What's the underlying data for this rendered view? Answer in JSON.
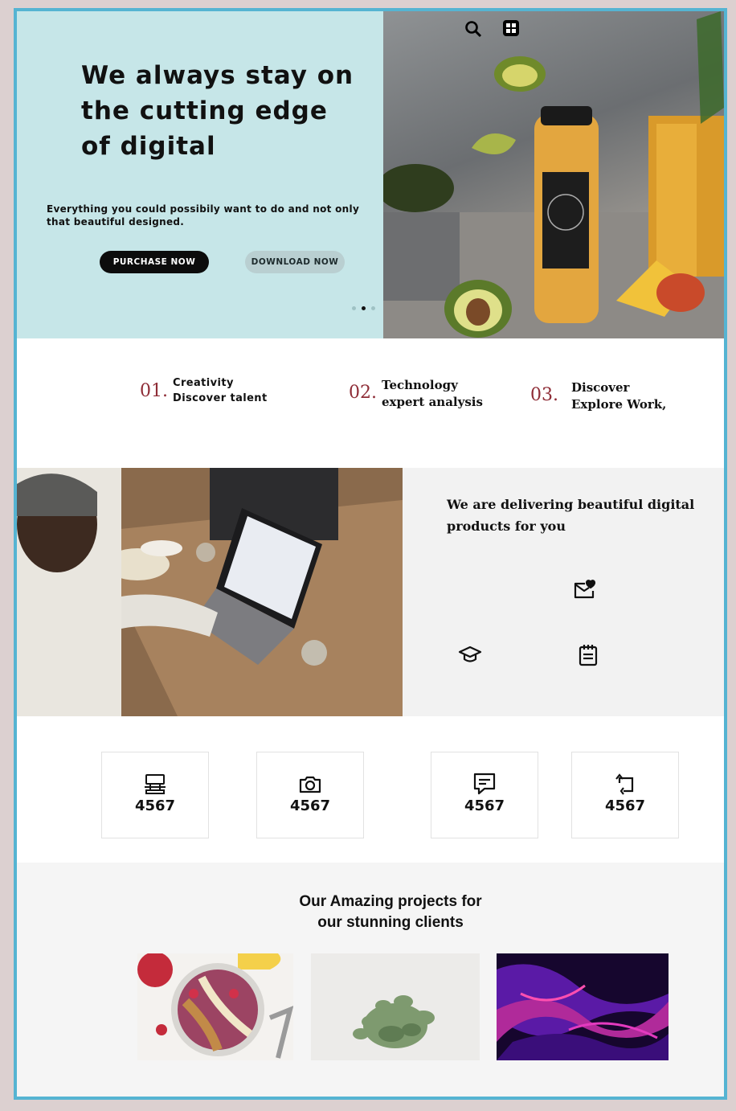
{
  "hero": {
    "title": "We always stay on the cutting edge of digital",
    "subtitle": "Everything you could possibily want to do and not only that beautiful designed.",
    "purchase_label": "PURCHASE NOW",
    "download_label": "DOWNLOAD NOW",
    "slider": {
      "dots": 3,
      "active": 2
    }
  },
  "header_icons": [
    "search-icon",
    "grid-menu-icon"
  ],
  "features": [
    {
      "number": "01.",
      "line1": "Creativity",
      "line2": "Discover talent"
    },
    {
      "number": "02.",
      "line1": "Technology",
      "line2": "expert analysis"
    },
    {
      "number": "03.",
      "line1": "Discover",
      "line2": "Explore Work,"
    }
  ],
  "about": {
    "title": "We are delivering beautiful digital products for you",
    "icons": [
      "mail-heart-icon",
      "graduation-cap-icon",
      "notepad-icon"
    ]
  },
  "stats": [
    {
      "icon": "computer-icon",
      "value": "4567"
    },
    {
      "icon": "camera-icon",
      "value": "4567"
    },
    {
      "icon": "message-icon",
      "value": "4567"
    },
    {
      "icon": "repeat-icon",
      "value": "4567"
    }
  ],
  "projects": {
    "title_line1": "Our Amazing projects for",
    "title_line2": "our stunning clients",
    "items": [
      "smoothie-bowl-image",
      "plant-image",
      "abstract-fluid-image"
    ]
  },
  "colors": {
    "hero_bg": "#c6e6e8",
    "accent_number": "#8e2c36",
    "frame_border": "#55b4d2",
    "page_bg": "#dcd0d0"
  }
}
